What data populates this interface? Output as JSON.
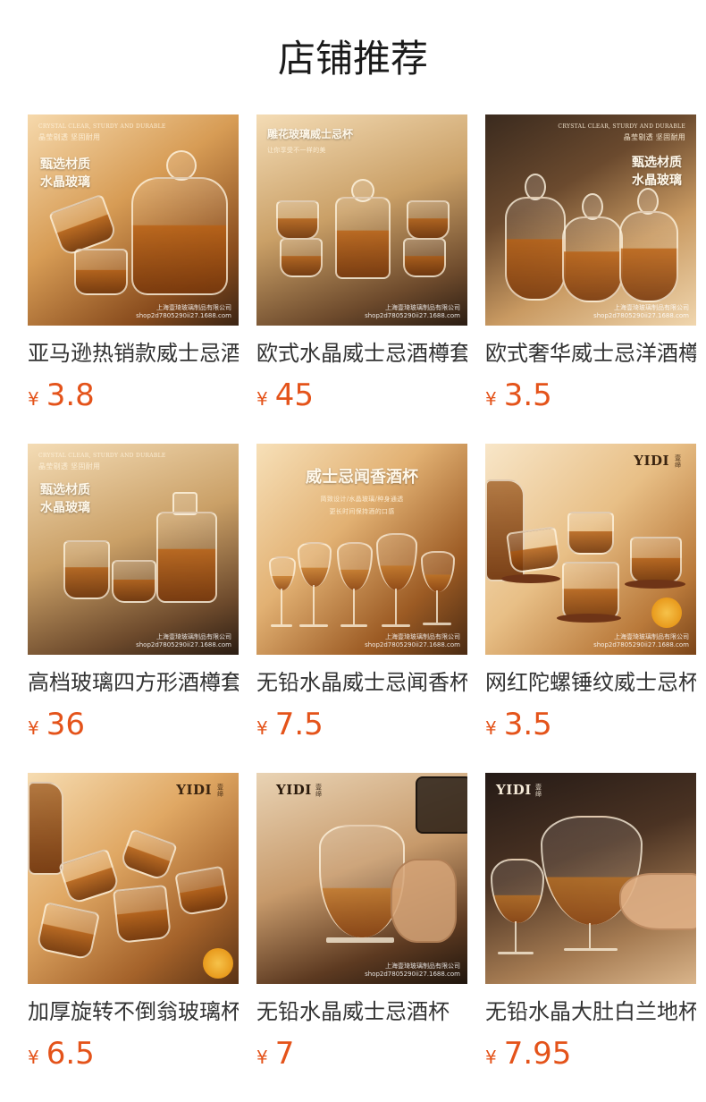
{
  "page": {
    "title": "店铺推荐"
  },
  "currency_symbol": "¥",
  "products": [
    {
      "name": "亚马逊热销款威士忌酒樽",
      "price": "3.8",
      "image": {
        "tagline_en": "CRYSTAL CLEAR, STURDY AND DURABLE",
        "tagline_cn": "晶莹剔透 坚固耐用",
        "promo_lines": [
          "甄选材质",
          "水晶玻璃"
        ],
        "watermark_lines": [
          "上海壹琦玻璃制品有限公司",
          "shop2d7805290ii27.1688.com"
        ]
      }
    },
    {
      "name": "欧式水晶威士忌酒樽套装",
      "price": "45",
      "image": {
        "promo_title": "雕花玻璃威士忌杯",
        "promo_sub": "让你享受不一样的美",
        "watermark_lines": [
          "上海壹琦玻璃制品有限公司",
          "shop2d7805290ii27.1688.com"
        ]
      }
    },
    {
      "name": "欧式奢华威士忌洋酒樽",
      "price": "3.5",
      "image": {
        "tagline_en": "CRYSTAL CLEAR, STURDY AND DURABLE",
        "tagline_cn": "晶莹剔透 坚固耐用",
        "promo_lines": [
          "甄选材质",
          "水晶玻璃"
        ],
        "watermark_lines": [
          "上海壹琦玻璃制品有限公司",
          "shop2d7805290ii27.1688.com"
        ]
      }
    },
    {
      "name": "高档玻璃四方形酒樽套装",
      "price": "36",
      "image": {
        "tagline_en": "CRYSTAL CLEAR, STURDY AND DURABLE",
        "tagline_cn": "晶莹剔透 坚固耐用",
        "promo_lines": [
          "甄选材质",
          "水晶玻璃"
        ],
        "watermark_lines": [
          "上海壹琦玻璃制品有限公司",
          "shop2d7805290ii27.1688.com"
        ]
      }
    },
    {
      "name": "无铅水晶威士忌闻香杯",
      "price": "7.5",
      "image": {
        "promo_title": "威士忌闻香酒杯",
        "promo_sub_lines": [
          "简致设计/水晶玻璃/种身通透",
          "更长时间保持酒的口感"
        ],
        "watermark_lines": [
          "上海壹琦玻璃制品有限公司",
          "shop2d7805290ii27.1688.com"
        ]
      }
    },
    {
      "name": "网红陀螺锤纹威士忌杯",
      "price": "3.5",
      "image": {
        "brand": "YIDI",
        "brand_sub": "壹缔",
        "watermark_lines": [
          "上海壹琦玻璃制品有限公司",
          "shop2d7805290ii27.1688.com"
        ]
      }
    },
    {
      "name": "加厚旋转不倒翁玻璃杯",
      "price": "6.5",
      "image": {
        "brand": "YIDI",
        "brand_sub": "壹缔"
      }
    },
    {
      "name": "无铅水晶威士忌酒杯",
      "price": "7",
      "image": {
        "brand": "YIDI",
        "brand_sub": "壹缔",
        "watermark_lines": [
          "上海壹琦玻璃制品有限公司",
          "shop2d7805290ii27.1688.com"
        ]
      }
    },
    {
      "name": "无铅水晶大肚白兰地杯",
      "price": "7.95",
      "image": {
        "brand": "YIDI",
        "brand_sub": "壹缔"
      }
    }
  ]
}
